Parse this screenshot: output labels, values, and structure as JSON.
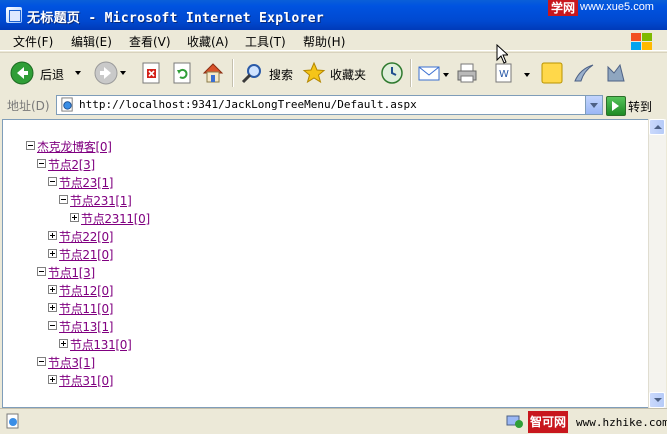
{
  "window": {
    "title": "无标题页 - Microsoft Internet Explorer",
    "watermark_tag": "学网",
    "watermark_url": "www.xue5.com"
  },
  "menubar": {
    "items": [
      "文件(F)",
      "编辑(E)",
      "查看(V)",
      "收藏(A)",
      "工具(T)",
      "帮助(H)"
    ]
  },
  "toolbar": {
    "back_label": "后退",
    "search_label": "搜索",
    "favorites_label": "收藏夹"
  },
  "addressbar": {
    "label": "地址(D)",
    "url": "http://localhost:9341/JackLongTreeMenu/Default.aspx",
    "go_label": "转到"
  },
  "tree": [
    {
      "label": "杰克龙博客[0]",
      "expanded": true,
      "level": 0
    },
    {
      "label": "节点2[3]",
      "expanded": true,
      "level": 1
    },
    {
      "label": "节点23[1]",
      "expanded": true,
      "level": 2
    },
    {
      "label": "节点231[1]",
      "expanded": true,
      "level": 3
    },
    {
      "label": "节点2311[0]",
      "expanded": false,
      "level": 4
    },
    {
      "label": "节点22[0]",
      "expanded": false,
      "level": 2
    },
    {
      "label": "节点21[0]",
      "expanded": false,
      "level": 2
    },
    {
      "label": "节点1[3]",
      "expanded": true,
      "level": 1
    },
    {
      "label": "节点12[0]",
      "expanded": false,
      "level": 2
    },
    {
      "label": "节点11[0]",
      "expanded": false,
      "level": 2
    },
    {
      "label": "节点13[1]",
      "expanded": true,
      "level": 2
    },
    {
      "label": "节点131[0]",
      "expanded": false,
      "level": 3
    },
    {
      "label": "节点3[1]",
      "expanded": true,
      "level": 1
    },
    {
      "label": "节点31[0]",
      "expanded": false,
      "level": 2
    }
  ],
  "statusbar": {
    "watermark_tag": "智可网",
    "watermark_url": "www.hzhike.com"
  },
  "colors": {
    "titlebar": "#0053e0",
    "visited_link": "#800080",
    "chrome": "#ece9d8",
    "watermark_red": "#c8171d"
  }
}
